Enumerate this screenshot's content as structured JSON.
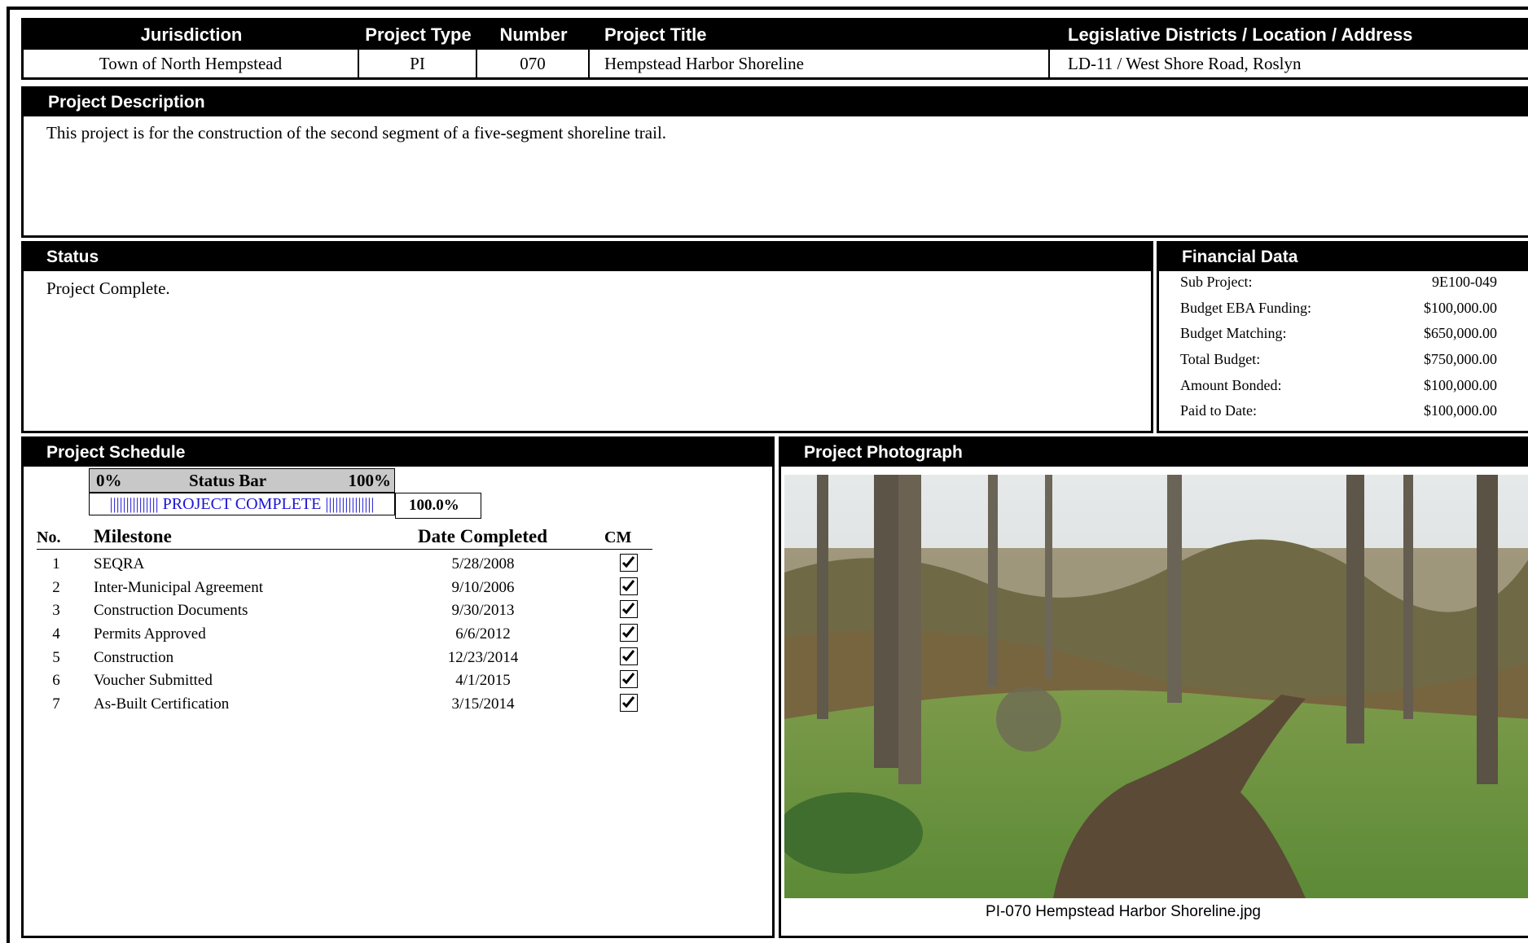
{
  "header_table": {
    "columns": {
      "jurisdiction": "Jurisdiction",
      "project_type": "Project Type",
      "number": "Number",
      "project_title": "Project Title",
      "legislative": "Legislative Districts / Location / Address"
    },
    "values": {
      "jurisdiction": "Town of North Hempstead",
      "project_type": "PI",
      "number": "070",
      "project_title": "Hempstead Harbor Shoreline",
      "legislative": "LD-11 / West Shore Road, Roslyn"
    }
  },
  "description": {
    "title": "Project Description",
    "text": "This project is for the construction of the second segment of a five-segment shoreline trail."
  },
  "status": {
    "title": "Status",
    "text": "Project Complete."
  },
  "financial": {
    "title": "Financial Data",
    "rows": [
      {
        "label": "Sub Project:",
        "value": "9E100-049"
      },
      {
        "label": "Budget EBA Funding:",
        "value": "$100,000.00"
      },
      {
        "label": "Budget Matching:",
        "value": "$650,000.00"
      },
      {
        "label": "Total Budget:",
        "value": "$750,000.00"
      },
      {
        "label": "Amount Bonded:",
        "value": "$100,000.00"
      },
      {
        "label": "Paid to Date:",
        "value": "$100,000.00"
      }
    ]
  },
  "schedule": {
    "title": "Project Schedule",
    "status_bar": {
      "min_label": "0%",
      "title": "Status Bar",
      "max_label": "100%",
      "text": "||||||||||||||| PROJECT COMPLETE |||||||||||||||",
      "percent_text": "100.0%",
      "fraction": 1.0
    },
    "columns": {
      "no": "No.",
      "milestone": "Milestone",
      "date": "Date Completed",
      "cm": "CM"
    },
    "milestones": [
      {
        "no": "1",
        "name": "SEQRA",
        "date": "5/28/2008",
        "cm": true
      },
      {
        "no": "2",
        "name": "Inter-Municipal Agreement",
        "date": "9/10/2006",
        "cm": true
      },
      {
        "no": "3",
        "name": "Construction Documents",
        "date": "9/30/2013",
        "cm": true
      },
      {
        "no": "4",
        "name": "Permits Approved",
        "date": "6/6/2012",
        "cm": true
      },
      {
        "no": "5",
        "name": "Construction",
        "date": "12/23/2014",
        "cm": true
      },
      {
        "no": "6",
        "name": "Voucher Submitted",
        "date": "4/1/2015",
        "cm": true
      },
      {
        "no": "7",
        "name": "As-Built Certification",
        "date": "3/15/2014",
        "cm": true
      }
    ]
  },
  "photo": {
    "title": "Project Photograph",
    "caption": "PI-070 Hempstead Harbor Shoreline.jpg"
  },
  "colors": {
    "header_bg": "#000000",
    "status_bar_bg": "#c8c8c8",
    "status_bar_text": "#1b14d6"
  }
}
